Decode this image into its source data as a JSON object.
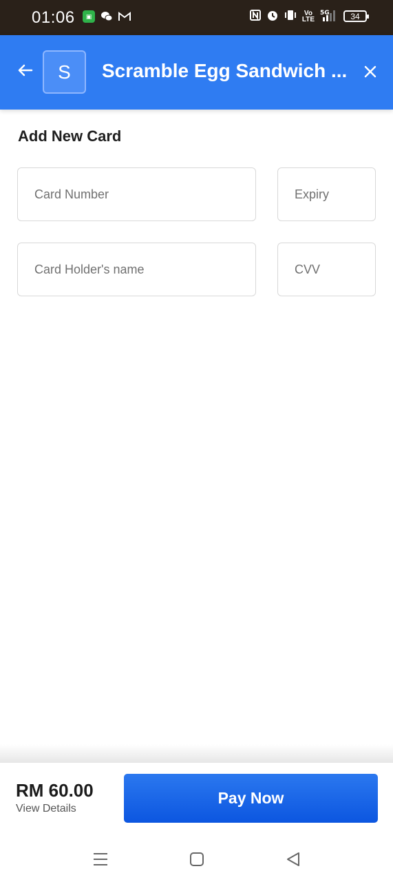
{
  "status_bar": {
    "time": "01:06",
    "battery": "34",
    "icons": [
      "notification-app-icon",
      "wechat-icon",
      "gmail-icon",
      "nfc-icon",
      "alarm-icon",
      "vibrate-icon",
      "volte-icon",
      "5g-signal-icon",
      "battery-icon"
    ]
  },
  "header": {
    "avatar_letter": "S",
    "title": "Scramble Egg Sandwich ...",
    "accent_color": "#2f7cf2"
  },
  "form": {
    "title": "Add New Card",
    "card_number_placeholder": "Card Number",
    "expiry_placeholder": "Expiry",
    "holder_placeholder": "Card Holder's name",
    "cvv_placeholder": "CVV"
  },
  "footer": {
    "amount": "RM 60.00",
    "view_details": "View Details",
    "pay_label": "Pay Now",
    "pay_color": "#0c56e0"
  },
  "nav": {
    "icons": [
      "menu-icon",
      "home-icon",
      "back-triangle-icon"
    ]
  }
}
